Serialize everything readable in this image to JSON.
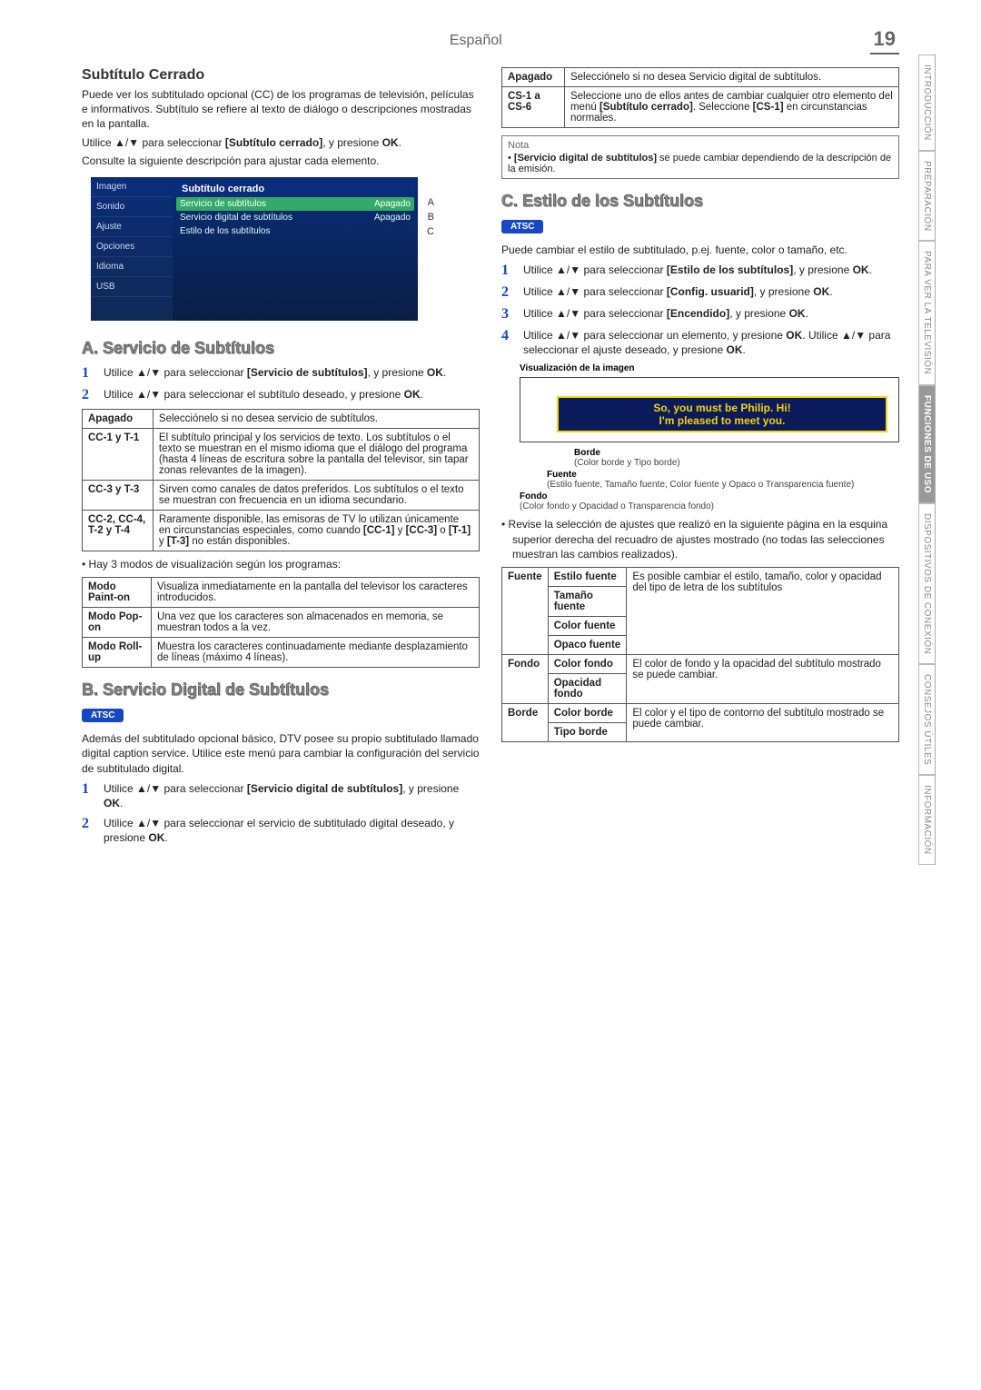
{
  "header": {
    "lang": "Español",
    "page": "19"
  },
  "sidetabs": [
    "INTRODUCCIÓN",
    "PREPARACIÓN",
    "PARA VER LA TELEVISIÓN",
    "FUNCIONES DE USO",
    "DISPOSITIVOS DE CONEXIÓN",
    "CONSEJOS ÚTILES",
    "INFORMACIÓN"
  ],
  "sidetabs_active_index": 3,
  "left": {
    "title": "Subtítulo Cerrado",
    "intro": "Puede ver los subtitulado opcional (CC) de los programas de televisión, películas e informativos. Subtítulo se refiere al texto de diálogo o descripciones mostradas en la pantalla.",
    "nav1_a": "Utilice ",
    "nav1_b": " para seleccionar ",
    "nav1_bold": "[Subtítulo cerrado]",
    "nav1_c": ", y presione ",
    "nav1_ok": "OK",
    "nav1_d": ".",
    "nav2": "Consulte la siguiente descripción para ajustar cada elemento.",
    "osd": {
      "header": "Subtítulo cerrado",
      "nav": [
        "Imagen",
        "Sonido",
        "Ajuste",
        "Opciones",
        "Idioma",
        "USB"
      ],
      "rows": [
        {
          "l": "Servicio de subtítulos",
          "r": "Apagado",
          "tag": "A"
        },
        {
          "l": "Servicio digital de subtítulos",
          "r": "Apagado",
          "tag": "B"
        },
        {
          "l": "Estilo de los subtítulos",
          "r": "",
          "tag": "C"
        }
      ]
    },
    "secA": {
      "head": "A. Servicio de Subtítulos",
      "s1_a": "Utilice ",
      "s1_b": " para seleccionar ",
      "s1_bold": "[Servicio de subtítulos]",
      "s1_c": ", y presione ",
      "s1_ok": "OK",
      "s1_d": ".",
      "s2_a": "Utilice ",
      "s2_b": " para seleccionar el subtítulo deseado, y presione ",
      "s2_ok": "OK",
      "s2_c": ".",
      "t1": [
        {
          "k": "Apagado",
          "v": "Selecciónelo si no desea servicio de subtítulos."
        },
        {
          "k": "CC-1 y T-1",
          "v": "El subtítulo principal y los servicios de texto. Los subtítulos o el texto se muestran en el mismo idioma que el diálogo del programa (hasta 4 líneas de escritura sobre la pantalla del televisor, sin tapar zonas relevantes de la imagen)."
        },
        {
          "k": "CC-3 y T-3",
          "v": "Sirven como canales de datos preferidos. Los subtítulos o el texto se muestran con frecuencia en un idioma secundario."
        },
        {
          "k": "CC-2, CC-4, T-2 y T-4",
          "v_pre": "Raramente disponible, las emisoras de TV lo utilizan únicamente en circunstancias especiales, como cuando ",
          "v_b1": "[CC-1]",
          "v_mid1": " y ",
          "v_b2": "[CC-3]",
          "v_mid2": " o ",
          "v_b3": "[T-1]",
          "v_mid3": " y ",
          "v_b4": "[T-3]",
          "v_post": " no están disponibles."
        }
      ],
      "note3": "Hay 3 modos de visualización según los programas:",
      "t2": [
        {
          "k": "Modo Paint-on",
          "v": "Visualiza inmediatamente en la pantalla del televisor los caracteres introducidos."
        },
        {
          "k": "Modo Pop-on",
          "v": "Una vez que los caracteres son almacenados en memoria, se muestran todos a la vez."
        },
        {
          "k": "Modo Roll-up",
          "v": "Muestra los caracteres continuadamente mediante desplazamiento de líneas (máximo 4 líneas)."
        }
      ]
    },
    "secB": {
      "head": "B. Servicio Digital de Subtítulos",
      "atsc": "ATSC",
      "intro": "Además del subtitulado opcional básico, DTV posee su propio subtitulado llamado digital caption service. Utilice este menú para cambiar la configuración del servicio de subtitulado digital.",
      "s1_a": "Utilice ",
      "s1_b": " para seleccionar ",
      "s1_bold": "[Servicio digital de subtítulos]",
      "s1_c": ", y presione ",
      "s1_ok": "OK",
      "s1_d": ".",
      "s2_a": "Utilice ",
      "s2_b": " para seleccionar el servicio de subtitulado digital deseado, y presione ",
      "s2_ok": "OK",
      "s2_c": "."
    }
  },
  "right": {
    "t1": [
      {
        "k": "Apagado",
        "v": "Selecciónelo si no desea Servicio digital de subtítulos."
      },
      {
        "k": "CS-1 a CS-6",
        "v_pre": "Seleccione uno de ellos antes de cambiar cualquier otro elemento del menú ",
        "v_b1": "[Subtítulo cerrado]",
        "v_mid": ". Seleccione ",
        "v_b2": "[CS-1]",
        "v_post": " en circunstancias normales."
      }
    ],
    "note": {
      "label": "Nota",
      "body_b": "[Servicio digital de subtítulos]",
      "body_rest": " se puede cambiar dependiendo de la descripción de la emisión."
    },
    "secC": {
      "head": "C. Estilo de los Subtítulos",
      "atsc": "ATSC",
      "intro": "Puede cambiar el estilo de subtitulado, p.ej. fuente, color o tamaño, etc.",
      "s1_a": "Utilice ",
      "s1_b": " para seleccionar ",
      "s1_bold": "[Estilo de los subtítulos]",
      "s1_c": ", y presione ",
      "s1_ok": "OK",
      "s1_d": ".",
      "s2_a": "Utilice ",
      "s2_b": " para seleccionar ",
      "s2_bold": "[Config. usuarid]",
      "s2_c": ", y presione ",
      "s2_ok": "OK",
      "s2_d": ".",
      "s3_a": "Utilice ",
      "s3_b": " para seleccionar ",
      "s3_bold": "[Encendido]",
      "s3_c": ", y presione ",
      "s3_ok": "OK",
      "s3_d": ".",
      "s4_a": "Utilice ",
      "s4_b": " para seleccionar un elemento, y presione ",
      "s4_ok": "OK",
      "s4_c": ". Utilice ",
      "s4_d": " para seleccionar el ajuste deseado, y presione ",
      "s4_ok2": "OK",
      "s4_e": ".",
      "diag": {
        "vis": "Visualización de la imagen",
        "sub1": "So, you must be Philip. Hi!",
        "sub2": "I'm pleased to meet you.",
        "borde_t": "Borde",
        "borde_d": "(Color borde y Tipo borde)",
        "fuente_t": "Fuente",
        "fuente_d": "(Estilo fuente, Tamaño fuente, Color fuente y Opaco o Transparencia fuente)",
        "fondo_t": "Fondo",
        "fondo_d": "(Color fondo y Opacidad o Transparencia fondo)"
      },
      "review": "Revise la selección de ajustes que realizó en la siguiente página en la esquina superior derecha del recuadro de ajustes mostrado (no todas las selecciones muestran las cambios realizados).",
      "t3": {
        "r1k": "Fuente",
        "r1a": "Estilo fuente",
        "r1b": "Tamaño fuente",
        "r1c": "Color fuente",
        "r1d": "Opaco fuente",
        "r1v": "Es posible cambiar el estilo, tamaño, color y opacidad del tipo de letra de los subtítulos",
        "r2k": "Fondo",
        "r2a": "Color fondo",
        "r2b": "Opacidad fondo",
        "r2v": "El color de fondo y la opacidad del subtítulo mostrado se puede cambiar.",
        "r3k": "Borde",
        "r3a": "Color borde",
        "r3b": "Tipo borde",
        "r3v": "El color y el tipo de contorno del subtítulo mostrado se puede cambiar."
      }
    }
  }
}
